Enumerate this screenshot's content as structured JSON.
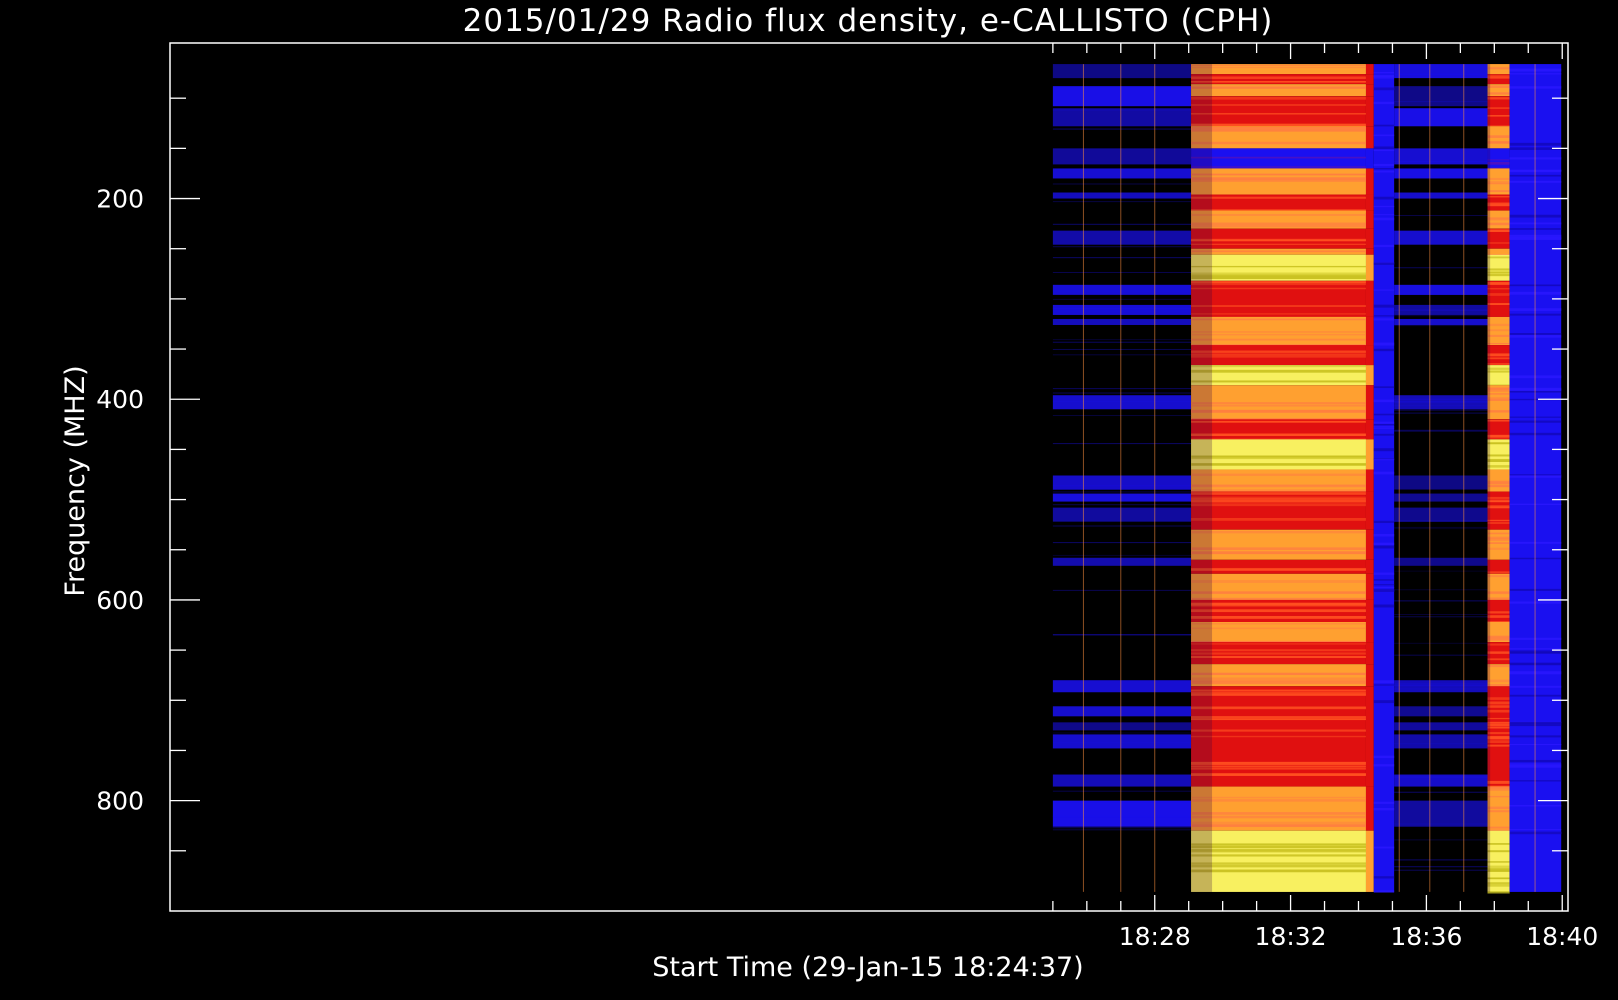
{
  "chart_data": {
    "type": "heatmap",
    "title": "2015/01/29  Radio flux density, e-CALLISTO (CPH)",
    "xlabel": "Start Time (29-Jan-15 18:24:37)",
    "ylabel": "Frequency (MHZ)",
    "x_start_time": "18:24:37",
    "xlim_minutes": [
      -1,
      40.17
    ],
    "x_ticks": [
      {
        "value": 28,
        "label": "18:28"
      },
      {
        "value": 32,
        "label": "18:32"
      },
      {
        "value": 36,
        "label": "18:36"
      },
      {
        "value": 40,
        "label": "18:40"
      }
    ],
    "x_minor_ticks": [
      25,
      26,
      27,
      28,
      29,
      30,
      31,
      32,
      33,
      34,
      35,
      36,
      37,
      38,
      39,
      40
    ],
    "ylim": [
      45,
      910
    ],
    "y_inverted": true,
    "y_ticks": [
      200,
      400,
      600,
      800
    ],
    "y_minor_ticks": [
      100,
      150,
      200,
      250,
      300,
      350,
      400,
      450,
      500,
      550,
      600,
      650,
      700,
      750,
      800,
      850
    ],
    "data_time_range_minutes": [
      25.0,
      39.97
    ],
    "data_freq_range_mhz": [
      66,
      891
    ],
    "colors": {
      "background": "#000000",
      "axes": "#ffffff",
      "quiet": "#000000",
      "low": "#1a10f0",
      "medium": "#e01010",
      "high": "#ffa030",
      "peak": "#f8f060"
    },
    "time_segments": [
      {
        "start": 25.0,
        "end": 29.07,
        "level": "quiet"
      },
      {
        "start": 29.07,
        "end": 34.22,
        "level": "active"
      },
      {
        "start": 34.22,
        "end": 34.45,
        "level": "transition"
      },
      {
        "start": 34.45,
        "end": 35.05,
        "level": "blue"
      },
      {
        "start": 35.05,
        "end": 37.8,
        "level": "quiet"
      },
      {
        "start": 37.8,
        "end": 38.45,
        "level": "active"
      },
      {
        "start": 38.45,
        "end": 39.97,
        "level": "blue"
      }
    ],
    "quiet_bands_mhz": [
      [
        66,
        80
      ],
      [
        88,
        108
      ],
      [
        110,
        128
      ],
      [
        150,
        166
      ],
      [
        170,
        180
      ],
      [
        194,
        200
      ],
      [
        232,
        246
      ],
      [
        286,
        296
      ],
      [
        306,
        316
      ],
      [
        320,
        326
      ],
      [
        396,
        410
      ],
      [
        476,
        490
      ],
      [
        494,
        502
      ],
      [
        508,
        522
      ],
      [
        558,
        566
      ],
      [
        680,
        692
      ],
      [
        706,
        716
      ],
      [
        722,
        730
      ],
      [
        734,
        748
      ],
      [
        774,
        786
      ],
      [
        800,
        826
      ]
    ],
    "active_profile_mhz": [
      {
        "from": 66,
        "to": 76,
        "level": "high"
      },
      {
        "from": 76,
        "to": 86,
        "level": "medium"
      },
      {
        "from": 86,
        "to": 98,
        "level": "high"
      },
      {
        "from": 98,
        "to": 128,
        "level": "medium"
      },
      {
        "from": 128,
        "to": 150,
        "level": "high"
      },
      {
        "from": 150,
        "to": 170,
        "level": "low"
      },
      {
        "from": 170,
        "to": 196,
        "level": "high"
      },
      {
        "from": 196,
        "to": 212,
        "level": "medium"
      },
      {
        "from": 212,
        "to": 230,
        "level": "high"
      },
      {
        "from": 230,
        "to": 250,
        "level": "medium"
      },
      {
        "from": 250,
        "to": 256,
        "level": "high"
      },
      {
        "from": 256,
        "to": 282,
        "level": "peak"
      },
      {
        "from": 282,
        "to": 318,
        "level": "medium"
      },
      {
        "from": 318,
        "to": 346,
        "level": "high"
      },
      {
        "from": 346,
        "to": 366,
        "level": "medium"
      },
      {
        "from": 366,
        "to": 386,
        "level": "peak"
      },
      {
        "from": 386,
        "to": 420,
        "level": "high"
      },
      {
        "from": 420,
        "to": 440,
        "level": "medium"
      },
      {
        "from": 440,
        "to": 470,
        "level": "peak"
      },
      {
        "from": 470,
        "to": 492,
        "level": "high"
      },
      {
        "from": 492,
        "to": 530,
        "level": "medium"
      },
      {
        "from": 530,
        "to": 560,
        "level": "high"
      },
      {
        "from": 560,
        "to": 574,
        "level": "medium"
      },
      {
        "from": 574,
        "to": 600,
        "level": "high"
      },
      {
        "from": 600,
        "to": 622,
        "level": "medium"
      },
      {
        "from": 622,
        "to": 642,
        "level": "high"
      },
      {
        "from": 642,
        "to": 664,
        "level": "medium"
      },
      {
        "from": 664,
        "to": 686,
        "level": "high"
      },
      {
        "from": 686,
        "to": 786,
        "level": "medium"
      },
      {
        "from": 786,
        "to": 830,
        "level": "high"
      },
      {
        "from": 830,
        "to": 891,
        "level": "peak"
      }
    ]
  }
}
